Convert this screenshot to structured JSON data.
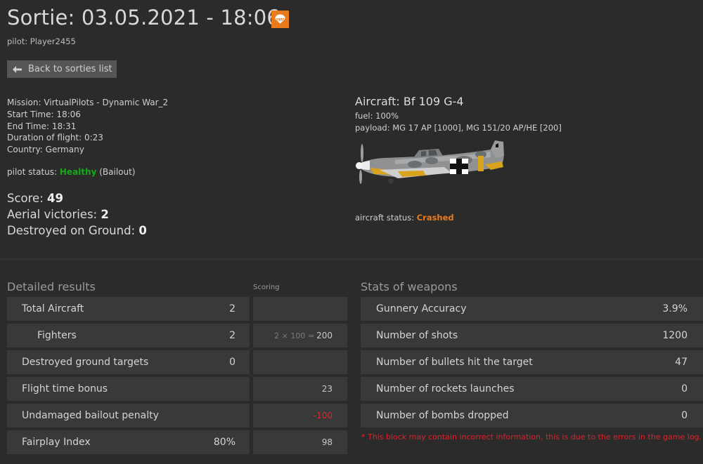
{
  "header": {
    "title": "Sortie: 03.05.2021 - 18:06",
    "pilot": "pilot: Player2455",
    "back_label": "Back to sorties list",
    "status_icon": "parachute-icon",
    "accent": "#e87b1e"
  },
  "mission": {
    "mission": "Mission: VirtualPilots - Dynamic War_2",
    "start_time": "Start Time: 18:06",
    "end_time": "End Time: 18:31",
    "duration": "Duration of flight: 0:23",
    "country": "Country: Germany",
    "pilot_status_label": "pilot status:",
    "pilot_status_value": "Healthy",
    "pilot_status_extra": "(Bailout)",
    "status_ok_color": "#18a81c"
  },
  "summary": {
    "score_label": "Score:",
    "score_value": "49",
    "aerial_label": "Aerial victories:",
    "aerial_value": "2",
    "ground_label": "Destroyed on Ground:",
    "ground_value": "0"
  },
  "aircraft": {
    "title": "Aircraft: Bf 109 G-4",
    "fuel": "fuel: 100%",
    "payload": "payload: MG 17 AP [1000], MG 151/20 AP/HE [200]",
    "status_label": "aircraft status:",
    "status_value": "Crashed",
    "status_color": "#e87b1e"
  },
  "detailed": {
    "heading": "Detailed results",
    "scoring_heading": "Scoring",
    "rows": [
      {
        "label": "Total Aircraft",
        "value": "2",
        "score_prefix": "",
        "score": ""
      },
      {
        "label": "Fighters",
        "value": "2",
        "score_prefix": "2 × 100 =",
        "score": "200"
      },
      {
        "label": "Destroyed ground targets",
        "value": "0",
        "score_prefix": "",
        "score": ""
      },
      {
        "label": "Flight time bonus",
        "value": "",
        "score_prefix": "",
        "score": "23"
      },
      {
        "label": "Undamaged bailout penalty",
        "value": "",
        "score_prefix": "",
        "score": "-100"
      },
      {
        "label": "Fairplay Index",
        "value": "80%",
        "score_prefix": "",
        "score": "98"
      }
    ],
    "penalty_color": "#e0262d"
  },
  "weapons": {
    "heading": "Stats of weapons",
    "rows": [
      {
        "label": "Gunnery Accuracy",
        "value": "3.9%"
      },
      {
        "label": "Number of shots",
        "value": "1200"
      },
      {
        "label": "Number of bullets hit the target",
        "value": "47"
      },
      {
        "label": "Number of rockets launches",
        "value": "0"
      },
      {
        "label": "Number of bombs dropped",
        "value": "0"
      }
    ],
    "note": "* This block may contain incorrect information, this is due to the errors in the game log."
  }
}
